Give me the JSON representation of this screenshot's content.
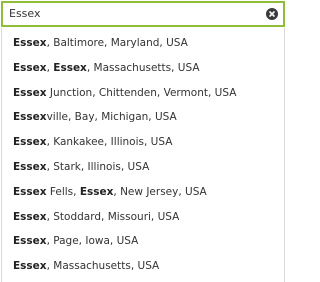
{
  "search": {
    "value": "Essex",
    "placeholder": ""
  },
  "icons": {
    "clear": "close-circle-icon"
  },
  "colors": {
    "focus_border": "#8fbf3a",
    "text": "#333333"
  },
  "suggestions": [
    {
      "parts": [
        {
          "text": "Essex",
          "bold": true
        },
        {
          "text": ", Baltimore, Maryland, USA",
          "bold": false
        }
      ]
    },
    {
      "parts": [
        {
          "text": "Essex",
          "bold": true
        },
        {
          "text": ", ",
          "bold": false
        },
        {
          "text": "Essex",
          "bold": true
        },
        {
          "text": ", Massachusetts, USA",
          "bold": false
        }
      ]
    },
    {
      "parts": [
        {
          "text": "Essex",
          "bold": true
        },
        {
          "text": " Junction, Chittenden, Vermont, USA",
          "bold": false
        }
      ]
    },
    {
      "parts": [
        {
          "text": "Essex",
          "bold": true
        },
        {
          "text": "ville, Bay, Michigan, USA",
          "bold": false
        }
      ]
    },
    {
      "parts": [
        {
          "text": "Essex",
          "bold": true
        },
        {
          "text": ", Kankakee, Illinois, USA",
          "bold": false
        }
      ]
    },
    {
      "parts": [
        {
          "text": "Essex",
          "bold": true
        },
        {
          "text": ", Stark, Illinois, USA",
          "bold": false
        }
      ]
    },
    {
      "parts": [
        {
          "text": "Essex",
          "bold": true
        },
        {
          "text": " Fells, ",
          "bold": false
        },
        {
          "text": "Essex",
          "bold": true
        },
        {
          "text": ", New Jersey, USA",
          "bold": false
        }
      ]
    },
    {
      "parts": [
        {
          "text": "Essex",
          "bold": true
        },
        {
          "text": ", Stoddard, Missouri, USA",
          "bold": false
        }
      ]
    },
    {
      "parts": [
        {
          "text": "Essex",
          "bold": true
        },
        {
          "text": ", Page, Iowa, USA",
          "bold": false
        }
      ]
    },
    {
      "parts": [
        {
          "text": "Essex",
          "bold": true
        },
        {
          "text": ", Massachusetts, USA",
          "bold": false
        }
      ]
    }
  ]
}
